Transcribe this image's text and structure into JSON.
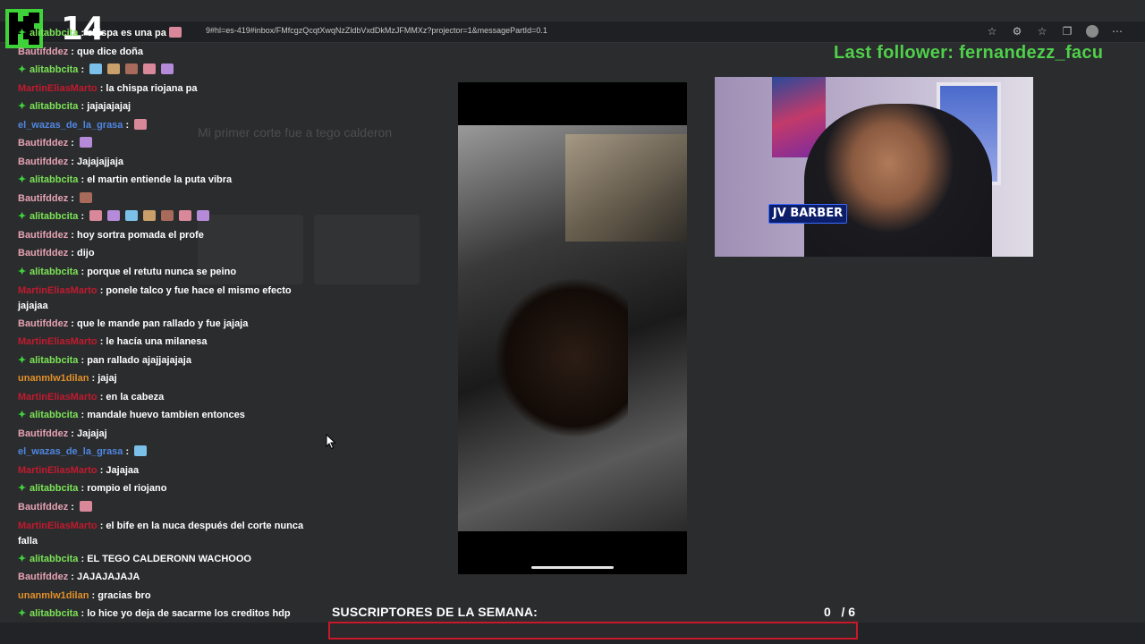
{
  "browser": {
    "url": "9#hl=es-419#inbox/FMfcgzQcqtXwqNzZldbVxdDkMzJFMMXz?projector=1&messagePartId=0.1"
  },
  "logo": {
    "number": "14"
  },
  "last_follower": "Last follower: fernandezz_facu",
  "colors": {
    "green": "#3fd33a",
    "follower_green": "#4fd04a",
    "goal_red": "#c8182a",
    "user_pink": "#e6a2b3",
    "user_red": "#c21a2e",
    "user_blue": "#4f86e0",
    "user_orange": "#e0902a",
    "user_green": "#7be356"
  },
  "chat": {
    "messages": [
      {
        "user": "alitabbcita",
        "text": "chispa es una pa",
        "badge": true,
        "color": "#7be356",
        "emotes": 1
      },
      {
        "user": "Bautifddez",
        "text": "que dice doña",
        "badge": false,
        "color": "#e6a2b3",
        "emotes": 0
      },
      {
        "user": "alitabbcita",
        "text": "",
        "badge": true,
        "color": "#7be356",
        "emotes": 5
      },
      {
        "user": "MartinEliasMarto",
        "text": "la chispa riojana pa",
        "badge": false,
        "color": "#c21a2e",
        "emotes": 0
      },
      {
        "user": "alitabbcita",
        "text": "jajajajajaj",
        "badge": true,
        "color": "#7be356",
        "emotes": 0
      },
      {
        "user": "el_wazas_de_la_grasa",
        "text": "",
        "badge": false,
        "color": "#4f86e0",
        "emotes": 1
      },
      {
        "user": "Bautifddez",
        "text": "",
        "badge": false,
        "color": "#e6a2b3",
        "emotes": 1
      },
      {
        "user": "Bautifddez",
        "text": "Jajajajjaja",
        "badge": false,
        "color": "#e6a2b3",
        "emotes": 0
      },
      {
        "user": "alitabbcita",
        "text": "el martin entiende la puta vibra",
        "badge": true,
        "color": "#7be356",
        "emotes": 0
      },
      {
        "user": "Bautifddez",
        "text": "",
        "badge": false,
        "color": "#e6a2b3",
        "emotes": 1
      },
      {
        "user": "alitabbcita",
        "text": "",
        "badge": true,
        "color": "#7be356",
        "emotes": 7
      },
      {
        "user": "Bautifddez",
        "text": "hoy sortra pomada el profe",
        "badge": false,
        "color": "#e6a2b3",
        "emotes": 0
      },
      {
        "user": "Bautifddez",
        "text": "dijo",
        "badge": false,
        "color": "#e6a2b3",
        "emotes": 0
      },
      {
        "user": "alitabbcita",
        "text": "porque el retutu nunca se peino",
        "badge": true,
        "color": "#7be356",
        "emotes": 0
      },
      {
        "user": "MartinEliasMarto",
        "text": "ponele talco y fue hace el mismo efecto jajajaa",
        "badge": false,
        "color": "#c21a2e",
        "emotes": 0,
        "wrap": true
      },
      {
        "user": "Bautifddez",
        "text": "que le mande pan rallado y fue jajaja",
        "badge": false,
        "color": "#e6a2b3",
        "emotes": 0
      },
      {
        "user": "MartinEliasMarto",
        "text": "le hacía una milanesa",
        "badge": false,
        "color": "#c21a2e",
        "emotes": 0
      },
      {
        "user": "alitabbcita",
        "text": "pan rallado ajajjajajaja",
        "badge": true,
        "color": "#7be356",
        "emotes": 0
      },
      {
        "user": "unanmlw1dilan",
        "text": "jajaj",
        "badge": false,
        "color": "#e0902a",
        "emotes": 0
      },
      {
        "user": "MartinEliasMarto",
        "text": "en la cabeza",
        "badge": false,
        "color": "#c21a2e",
        "emotes": 0
      },
      {
        "user": "alitabbcita",
        "text": "mandale huevo tambien entonces",
        "badge": true,
        "color": "#7be356",
        "emotes": 0
      },
      {
        "user": "Bautifddez",
        "text": "Jajajaj",
        "badge": false,
        "color": "#e6a2b3",
        "emotes": 0
      },
      {
        "user": "el_wazas_de_la_grasa",
        "text": "",
        "badge": false,
        "color": "#4f86e0",
        "emotes": 1
      },
      {
        "user": "MartinEliasMarto",
        "text": "Jajajaa",
        "badge": false,
        "color": "#c21a2e",
        "emotes": 0
      },
      {
        "user": "alitabbcita",
        "text": "rompio el riojano",
        "badge": true,
        "color": "#7be356",
        "emotes": 0
      },
      {
        "user": "Bautifddez",
        "text": "",
        "badge": false,
        "color": "#e6a2b3",
        "emotes": 1
      },
      {
        "user": "MartinEliasMarto",
        "text": "el bife en la nuca después del corte nunca falla",
        "badge": false,
        "color": "#c21a2e",
        "emotes": 0,
        "wrap": true
      },
      {
        "user": "alitabbcita",
        "text": "EL TEGO CALDERONN WACHOOO",
        "badge": true,
        "color": "#7be356",
        "emotes": 0
      },
      {
        "user": "Bautifddez",
        "text": "JAJAJAJAJA",
        "badge": false,
        "color": "#e6a2b3",
        "emotes": 0
      },
      {
        "user": "unanmlw1dilan",
        "text": "gracias bro",
        "badge": false,
        "color": "#e0902a",
        "emotes": 0
      },
      {
        "user": "alitabbcita",
        "text": "lo hice yo deja de sacarme los creditos hdp",
        "badge": true,
        "color": "#7be356",
        "emotes": 0
      }
    ]
  },
  "email_ghost": {
    "subject": "Mi primer corte fue a tego calderon"
  },
  "webcam": {
    "sign": "JV BARBER"
  },
  "subs_goal": {
    "label": "SUSCRIPTORES DE LA SEMANA:",
    "current": "0",
    "target": "6",
    "progress": 0
  }
}
